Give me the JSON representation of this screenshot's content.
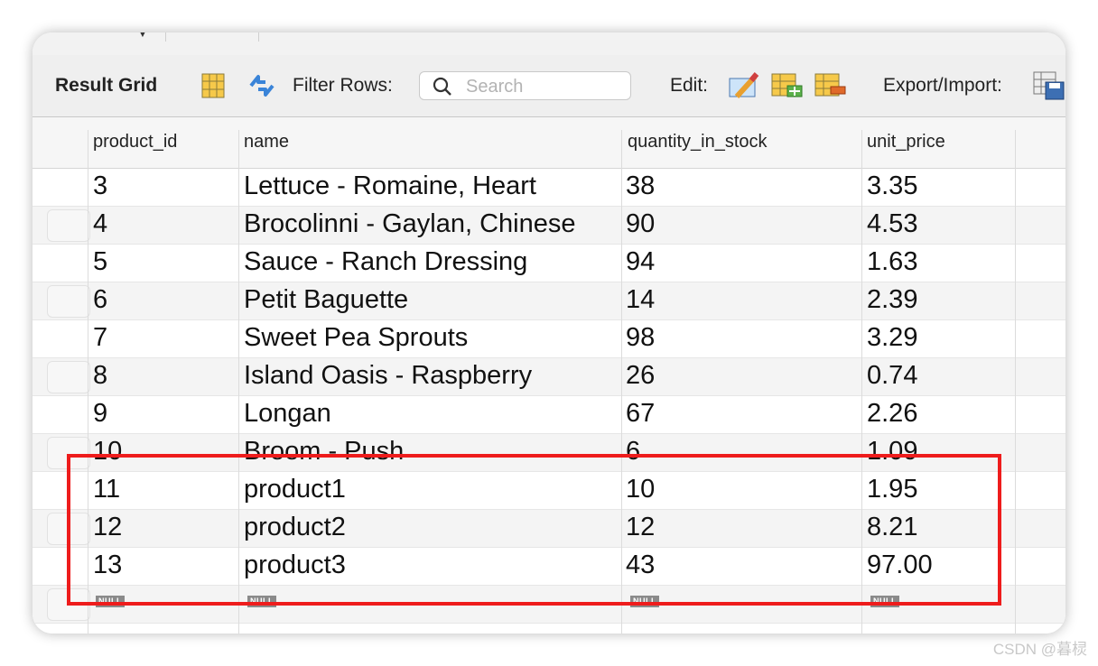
{
  "toolbar": {
    "title": "Result Grid",
    "filter_label": "Filter Rows:",
    "search_placeholder": "Search",
    "edit_label": "Edit:",
    "export_label": "Export/Import:"
  },
  "table": {
    "columns": [
      "product_id",
      "name",
      "quantity_in_stock",
      "unit_price"
    ],
    "rows": [
      [
        "3",
        "Lettuce - Romaine, Heart",
        "38",
        "3.35"
      ],
      [
        "4",
        "Brocolinni - Gaylan, Chinese",
        "90",
        "4.53"
      ],
      [
        "5",
        "Sauce - Ranch Dressing",
        "94",
        "1.63"
      ],
      [
        "6",
        "Petit Baguette",
        "14",
        "2.39"
      ],
      [
        "7",
        "Sweet Pea Sprouts",
        "98",
        "3.29"
      ],
      [
        "8",
        "Island Oasis - Raspberry",
        "26",
        "0.74"
      ],
      [
        "9",
        "Longan",
        "67",
        "2.26"
      ],
      [
        "10",
        "Broom - Push",
        "6",
        "1.09"
      ],
      [
        "11",
        "product1",
        "10",
        "1.95"
      ],
      [
        "12",
        "product2",
        "12",
        "8.21"
      ],
      [
        "13",
        "product3",
        "43",
        "97.00"
      ]
    ],
    "null_label": "NULL"
  },
  "highlight_color": "#ee1c1c",
  "watermark": "CSDN @暮棂"
}
